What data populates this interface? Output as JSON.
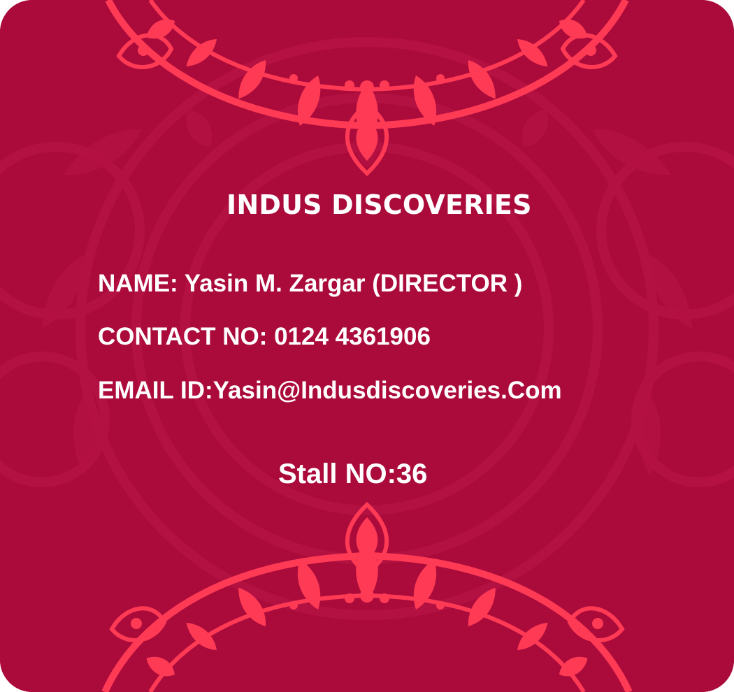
{
  "card": {
    "company_name": "INDUS DISCOVERIES",
    "name_line": "NAME: Yasin M. Zargar (DIRECTOR )",
    "contact_line": "CONTACT NO: 0124 4361906",
    "email_line": "EMAIL ID:Yasin@Indusdiscoveries.Com",
    "stall_line": "Stall NO:36"
  },
  "colors": {
    "background": "#ab0b3b",
    "ornament": "#ff3a55",
    "faint_pattern": "#b91446",
    "text": "#ffffff"
  },
  "icons": {
    "top": "mandala-ornament-icon",
    "bottom": "mandala-ornament-icon"
  }
}
